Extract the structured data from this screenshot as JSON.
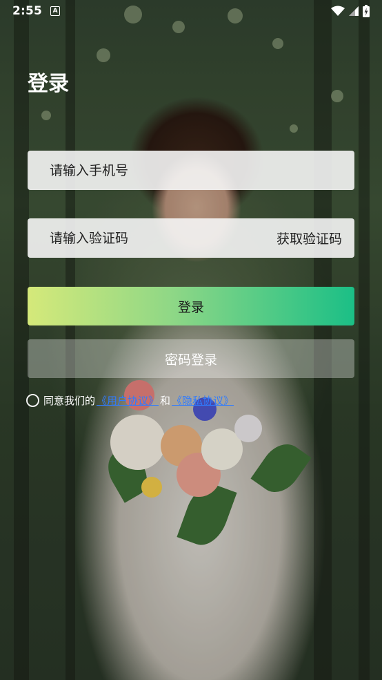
{
  "status_bar": {
    "time": "2:55",
    "notification_letter": "A"
  },
  "title": "登录",
  "phone_input": {
    "placeholder": "请输入手机号"
  },
  "code_input": {
    "placeholder": "请输入验证码",
    "get_code_label": "获取验证码"
  },
  "login_button": {
    "label": "登录",
    "gradient": [
      "#d5e97a",
      "#8dd786",
      "#1bbf86"
    ]
  },
  "password_login_button": {
    "label": "密码登录"
  },
  "agreement": {
    "prefix": "同意我们的",
    "user_agreement": "《用户协议》",
    "conjunction": "和",
    "privacy_policy": "《隐私协议》",
    "link_color": "#2f7bff"
  }
}
